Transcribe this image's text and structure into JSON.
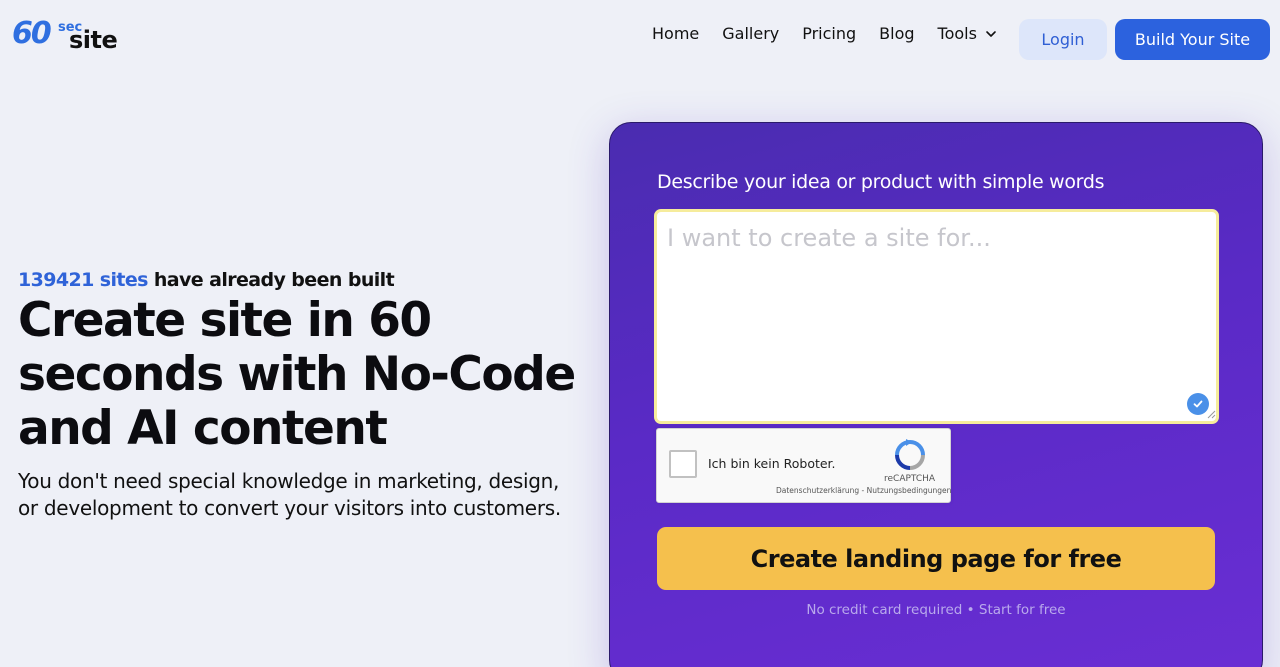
{
  "logo": {
    "number": "60",
    "sec": "sec",
    "site": "site"
  },
  "nav": {
    "items": [
      {
        "label": "Home"
      },
      {
        "label": "Gallery"
      },
      {
        "label": "Pricing"
      },
      {
        "label": "Blog"
      },
      {
        "label": "Tools"
      }
    ]
  },
  "header": {
    "login_label": "Login",
    "build_label": "Build Your Site"
  },
  "hero": {
    "counter_number": "139421 sites",
    "counter_text": "have already been built",
    "title": "Create site in 60 seconds with No-Code and AI content",
    "subtitle": "You don't need special knowledge in marketing, design, or development to convert your visitors into customers."
  },
  "form": {
    "label": "Describe your idea or product with simple words",
    "placeholder": "I want to create a site for...",
    "value": "",
    "captcha_label": "Ich bin kein Roboter.",
    "captcha_brand": "reCAPTCHA",
    "captcha_links": "Datenschutzerklärung - Nutzungsbedingungen",
    "submit_label": "Create landing page for free",
    "note": "No credit card required • Start for free"
  },
  "colors": {
    "accent": "#2c62de",
    "card_gradient_start": "#4a2cb0",
    "card_gradient_end": "#6a2ed4",
    "cta": "#f5c04d",
    "background": "#eef0f7"
  }
}
